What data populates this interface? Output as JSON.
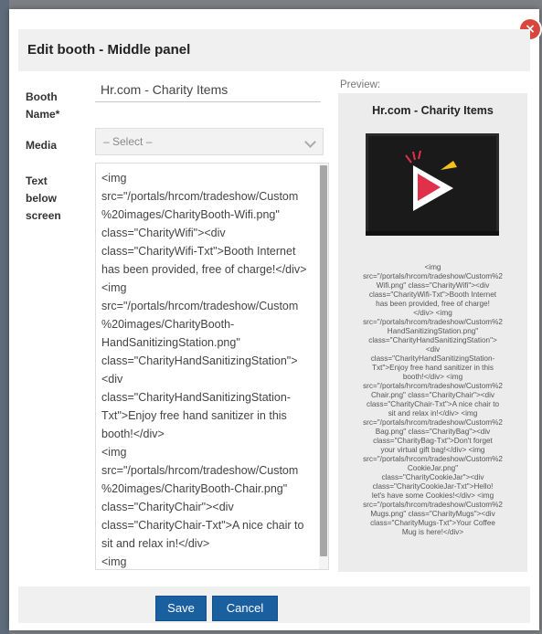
{
  "modal": {
    "title": "Edit booth - Middle panel",
    "close_label": "×"
  },
  "form": {
    "booth_name_label": "Booth\nName*",
    "booth_name_value": "Hr.com - Charity Items",
    "media_label": "Media",
    "media_selected": "– Select –",
    "text_label": "Text\nbelow\nscreen",
    "text_value": "<img\nsrc=\"/portals/hrcom/tradeshow/Custom\n%20images/CharityBooth-Wifi.png\"\nclass=\"CharityWifi\"><div\nclass=\"CharityWifi-Txt\">Booth Internet\nhas been provided, free of charge!</div>\n<img\nsrc=\"/portals/hrcom/tradeshow/Custom\n%20images/CharityBooth-\nHandSanitizingStation.png\"\nclass=\"CharityHandSanitizingStation\">\n<div\nclass=\"CharityHandSanitizingStation-\nTxt\">Enjoy free hand sanitizer in this\nbooth!</div>\n<img\nsrc=\"/portals/hrcom/tradeshow/Custom\n%20images/CharityBooth-Chair.png\"\nclass=\"CharityChair\"><div\nclass=\"CharityChair-Txt\">A nice chair to\nsit and relax in!</div>\n<img"
  },
  "preview": {
    "label": "Preview:",
    "title": "Hr.com - Charity Items",
    "text": "<img\nsrc=\"/portals/hrcom/tradeshow/Custom%2\nWifi.png\" class=\"CharityWifi\"><div\nclass=\"CharityWifi-Txt\">Booth Internet\nhas been provided, free of charge!\n</div> <img\nsrc=\"/portals/hrcom/tradeshow/Custom%2\nHandSanitizingStation.png\"\nclass=\"CharityHandSanitizingStation\">\n<div\nclass=\"CharityHandSanitizingStation-\nTxt\">Enjoy free hand sanitizer in this\nbooth!</div> <img\nsrc=\"/portals/hrcom/tradeshow/Custom%2\nChair.png\" class=\"CharityChair\"><div\nclass=\"CharityChair-Txt\">A nice chair to\nsit and relax in!</div> <img\nsrc=\"/portals/hrcom/tradeshow/Custom%2\nBag.png\" class=\"CharityBag\"><div\nclass=\"CharityBag-Txt\">Don't forget\nyour virtual gift bag!</div> <img\nsrc=\"/portals/hrcom/tradeshow/Custom%2\nCookieJar.png\"\nclass=\"CharityCookieJar\"><div\nclass=\"CharityCookieJar-Txt\">Hello!\nlet's have some Cookies!</div> <img\nsrc=\"/portals/hrcom/tradeshow/Custom%2\nMugs.png\" class=\"CharityMugs\"><div\nclass=\"CharityMugs-Txt\">Your Coffee\nMug is here!</div>"
  },
  "buttons": {
    "save": "Save",
    "cancel": "Cancel"
  },
  "colors": {
    "primary_button": "#1a5fa0",
    "close_button": "#d8473c"
  },
  "icons": [
    "close-icon",
    "chevron-down-icon",
    "play-logo-icon"
  ]
}
